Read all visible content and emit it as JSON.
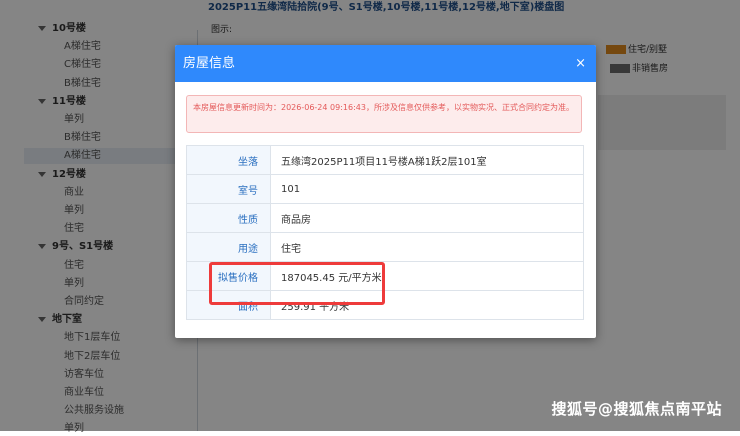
{
  "page": {
    "title": "2025P11五缘湾陆拾院(9号、S1号楼,10号楼,11号楼,12号楼,地下室)楼盘图"
  },
  "sidebar": {
    "nodes": [
      {
        "label": "10号楼",
        "kind": "group"
      },
      {
        "label": "A梯住宅",
        "kind": "leaf"
      },
      {
        "label": "C梯住宅",
        "kind": "leaf"
      },
      {
        "label": "B梯住宅",
        "kind": "leaf"
      },
      {
        "label": "11号楼",
        "kind": "group"
      },
      {
        "label": "单列",
        "kind": "leaf"
      },
      {
        "label": "B梯住宅",
        "kind": "leaf"
      },
      {
        "label": "A梯住宅",
        "kind": "leaf",
        "selected": true
      },
      {
        "label": "12号楼",
        "kind": "group"
      },
      {
        "label": "商业",
        "kind": "leaf"
      },
      {
        "label": "单列",
        "kind": "leaf"
      },
      {
        "label": "住宅",
        "kind": "leaf"
      },
      {
        "label": "9号、S1号楼",
        "kind": "group"
      },
      {
        "label": "住宅",
        "kind": "leaf"
      },
      {
        "label": "单列",
        "kind": "leaf"
      },
      {
        "label": "合同约定",
        "kind": "leaf"
      },
      {
        "label": "地下室",
        "kind": "group"
      },
      {
        "label": "地下1层车位",
        "kind": "leaf"
      },
      {
        "label": "地下2层车位",
        "kind": "leaf"
      },
      {
        "label": "访客车位",
        "kind": "leaf"
      },
      {
        "label": "商业车位",
        "kind": "leaf"
      },
      {
        "label": "公共服务设施",
        "kind": "leaf"
      },
      {
        "label": "单列",
        "kind": "leaf"
      }
    ]
  },
  "legend": {
    "title": "图示:",
    "items": [
      {
        "label": "住宅/别墅",
        "color": "#e08a1e"
      },
      {
        "label": "非销售房",
        "color": "#6b6b6b"
      }
    ]
  },
  "modal": {
    "title": "房屋信息",
    "close_glyph": "×",
    "notice": "本房屋信息更新时间为：2026-06-24 09:16:43，所涉及信息仅供参考，以实物实况、正式合同约定为准。",
    "rows": [
      {
        "label": "坐落",
        "value": "五缘湾2025P11项目11号楼A梯1跃2层101室"
      },
      {
        "label": "室号",
        "value": "101"
      },
      {
        "label": "性质",
        "value": "商品房"
      },
      {
        "label": "用途",
        "value": "住宅"
      },
      {
        "label": "拟售价格",
        "value": "187045.45 元/平方米"
      },
      {
        "label": "面积",
        "value": "259.91 平方米"
      }
    ]
  },
  "watermark": "搜狐号@搜狐焦点南平站",
  "colors": {
    "header_blue": "#2f89fc",
    "label_blue": "#2a6fc0",
    "notice_red": "#e45a5a",
    "highlight_red": "#ee3b3b"
  }
}
